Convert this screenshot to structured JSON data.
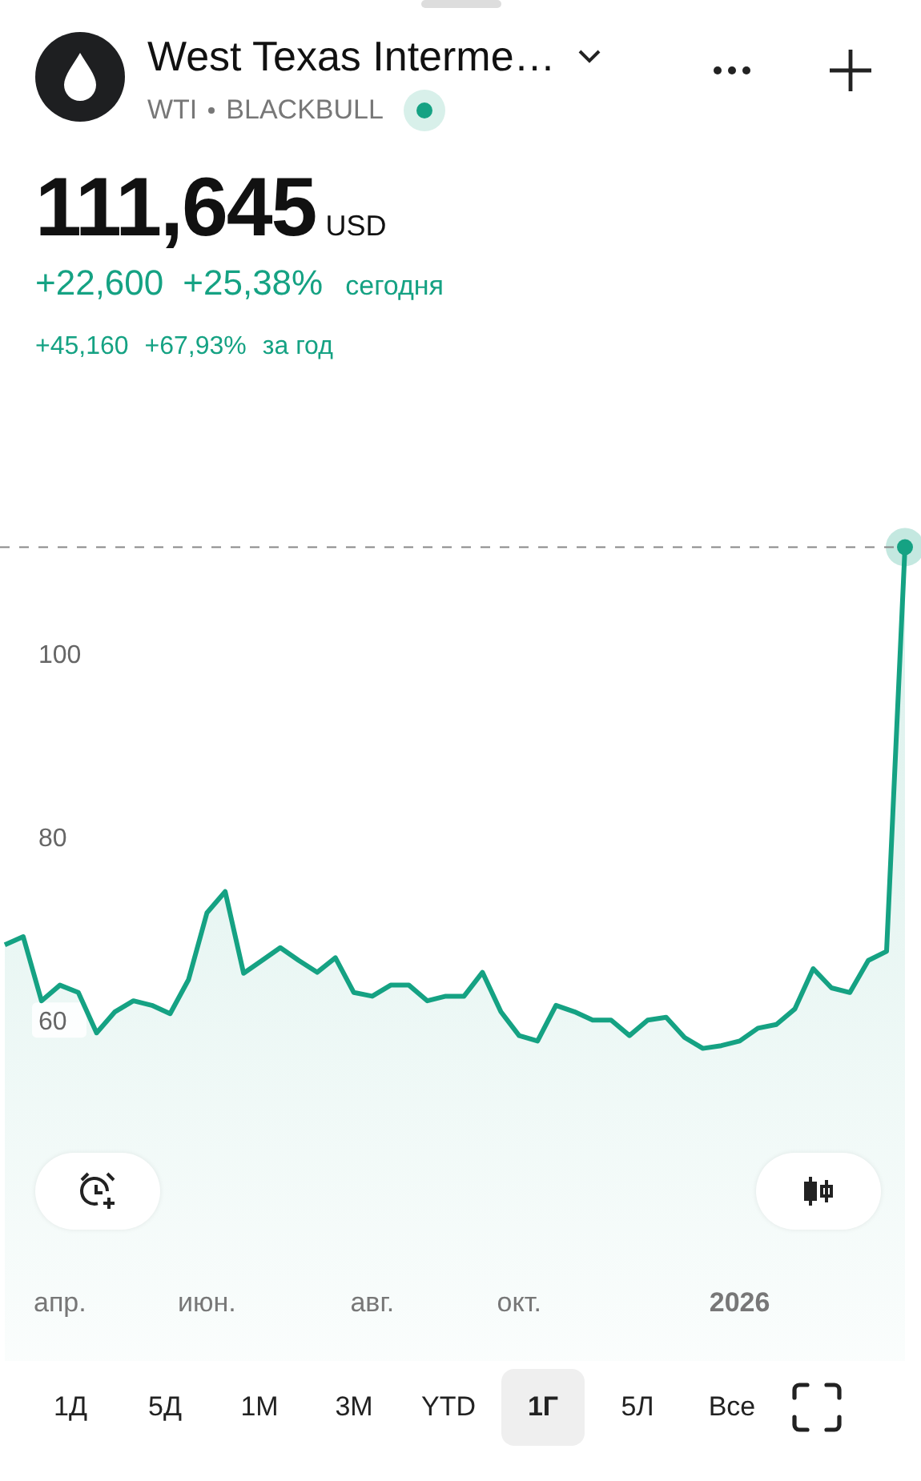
{
  "header": {
    "title": "West Texas Interme…",
    "symbol": "WTI",
    "exchange": "BLACKBULL",
    "live": true
  },
  "quote": {
    "price": "111,645",
    "currency": "USD",
    "change": "+22,600",
    "change_percent": "+25,38%",
    "change_period": "сегодня",
    "year_change": "+45,160",
    "year_change_percent": "+67,93%",
    "year_period": "за год"
  },
  "chart_data": {
    "type": "area",
    "categories": [
      null,
      null,
      null,
      "апр.",
      null,
      null,
      null,
      null,
      null,
      null,
      null,
      "июн.",
      null,
      null,
      null,
      null,
      null,
      null,
      null,
      null,
      "авг.",
      null,
      null,
      null,
      null,
      null,
      null,
      null,
      "окт.",
      null,
      null,
      null,
      null,
      null,
      null,
      null,
      null,
      null,
      null,
      null,
      "2026",
      null,
      null,
      null,
      null,
      null,
      null,
      null,
      null,
      null
    ],
    "series": [
      {
        "color": "#15a283",
        "values": [
          68.2,
          69.1,
          62.1,
          63.8,
          63,
          58.6,
          60.9,
          62.1,
          61.6,
          60.7,
          64.4,
          71.7,
          74,
          65.1,
          66.5,
          67.9,
          66.5,
          65.2,
          66.8,
          63,
          62.6,
          63.8,
          63.8,
          62.1,
          62.6,
          62.6,
          65.2,
          60.9,
          58.3,
          57.7,
          61.6,
          60.9,
          60,
          60,
          58.3,
          60,
          60.3,
          58.1,
          56.9,
          57.2,
          57.7,
          59.1,
          59.5,
          61.2,
          65.6,
          63.5,
          63,
          66.5,
          67.5,
          111.6
        ]
      }
    ],
    "ylim": [
      9.7,
      171.3
    ],
    "yticks": [
      60,
      80,
      100
    ]
  },
  "periods": [
    {
      "label": "1Д",
      "selected": false
    },
    {
      "label": "5Д",
      "selected": false
    },
    {
      "label": "1М",
      "selected": false
    },
    {
      "label": "3М",
      "selected": false
    },
    {
      "label": "YTD",
      "selected": false
    },
    {
      "label": "1Г",
      "selected": true
    },
    {
      "label": "5Л",
      "selected": false
    },
    {
      "label": "Все",
      "selected": false
    }
  ]
}
